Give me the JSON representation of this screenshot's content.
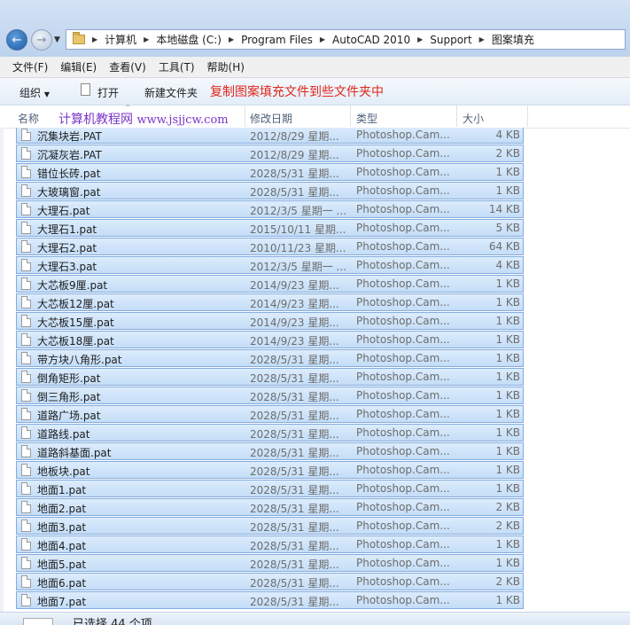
{
  "breadcrumb": [
    "计算机",
    "本地磁盘 (C:)",
    "Program Files",
    "AutoCAD 2010",
    "Support",
    "图案填充"
  ],
  "menu": [
    "文件(F)",
    "编辑(E)",
    "查看(V)",
    "工具(T)",
    "帮助(H)"
  ],
  "toolbar": {
    "organize": "组织",
    "open": "打开",
    "new_folder": "新建文件夹",
    "annotation": "复制图案填充文件到些文件夹中"
  },
  "columns": {
    "name": "名称",
    "date": "修改日期",
    "type": "类型",
    "size": "大小"
  },
  "watermark": {
    "text": "计算机教程网",
    "url": "www.jsjjcw.com"
  },
  "files": [
    {
      "name": "沉集块岩.PAT",
      "date": "2012/8/29 星期...",
      "type": "Photoshop.Cam...",
      "size": "4 KB"
    },
    {
      "name": "沉凝灰岩.PAT",
      "date": "2012/8/29 星期...",
      "type": "Photoshop.Cam...",
      "size": "2 KB"
    },
    {
      "name": "错位长砖.pat",
      "date": "2028/5/31 星期...",
      "type": "Photoshop.Cam...",
      "size": "1 KB"
    },
    {
      "name": "大玻璃窗.pat",
      "date": "2028/5/31 星期...",
      "type": "Photoshop.Cam...",
      "size": "1 KB"
    },
    {
      "name": "大理石.pat",
      "date": "2012/3/5 星期一 ...",
      "type": "Photoshop.Cam...",
      "size": "14 KB"
    },
    {
      "name": "大理石1.pat",
      "date": "2015/10/11 星期...",
      "type": "Photoshop.Cam...",
      "size": "5 KB"
    },
    {
      "name": "大理石2.pat",
      "date": "2010/11/23 星期...",
      "type": "Photoshop.Cam...",
      "size": "64 KB"
    },
    {
      "name": "大理石3.pat",
      "date": "2012/3/5 星期一 ...",
      "type": "Photoshop.Cam...",
      "size": "4 KB"
    },
    {
      "name": "大芯板9厘.pat",
      "date": "2014/9/23 星期...",
      "type": "Photoshop.Cam...",
      "size": "1 KB"
    },
    {
      "name": "大芯板12厘.pat",
      "date": "2014/9/23 星期...",
      "type": "Photoshop.Cam...",
      "size": "1 KB"
    },
    {
      "name": "大芯板15厘.pat",
      "date": "2014/9/23 星期...",
      "type": "Photoshop.Cam...",
      "size": "1 KB"
    },
    {
      "name": "大芯板18厘.pat",
      "date": "2014/9/23 星期...",
      "type": "Photoshop.Cam...",
      "size": "1 KB"
    },
    {
      "name": "带方块八角形.pat",
      "date": "2028/5/31 星期...",
      "type": "Photoshop.Cam...",
      "size": "1 KB"
    },
    {
      "name": "倒角矩形.pat",
      "date": "2028/5/31 星期...",
      "type": "Photoshop.Cam...",
      "size": "1 KB"
    },
    {
      "name": "倒三角形.pat",
      "date": "2028/5/31 星期...",
      "type": "Photoshop.Cam...",
      "size": "1 KB"
    },
    {
      "name": "道路广场.pat",
      "date": "2028/5/31 星期...",
      "type": "Photoshop.Cam...",
      "size": "1 KB"
    },
    {
      "name": "道路线.pat",
      "date": "2028/5/31 星期...",
      "type": "Photoshop.Cam...",
      "size": "1 KB"
    },
    {
      "name": "道路斜基面.pat",
      "date": "2028/5/31 星期...",
      "type": "Photoshop.Cam...",
      "size": "1 KB"
    },
    {
      "name": "地板块.pat",
      "date": "2028/5/31 星期...",
      "type": "Photoshop.Cam...",
      "size": "1 KB"
    },
    {
      "name": "地面1.pat",
      "date": "2028/5/31 星期...",
      "type": "Photoshop.Cam...",
      "size": "1 KB"
    },
    {
      "name": "地面2.pat",
      "date": "2028/5/31 星期...",
      "type": "Photoshop.Cam...",
      "size": "2 KB"
    },
    {
      "name": "地面3.pat",
      "date": "2028/5/31 星期...",
      "type": "Photoshop.Cam...",
      "size": "2 KB"
    },
    {
      "name": "地面4.pat",
      "date": "2028/5/31 星期...",
      "type": "Photoshop.Cam...",
      "size": "1 KB"
    },
    {
      "name": "地面5.pat",
      "date": "2028/5/31 星期...",
      "type": "Photoshop.Cam...",
      "size": "1 KB"
    },
    {
      "name": "地面6.pat",
      "date": "2028/5/31 星期...",
      "type": "Photoshop.Cam...",
      "size": "2 KB"
    },
    {
      "name": "地面7.pat",
      "date": "2028/5/31 星期...",
      "type": "Photoshop.Cam...",
      "size": "1 KB"
    }
  ],
  "status": {
    "text": "已选择 44 个项"
  },
  "colors": {
    "selection_fill": "#cfe3fa",
    "selection_border": "#84acdd",
    "annotation": "#e0271c",
    "watermark": "#7a35c8"
  },
  "icons": {
    "back": "back-arrow-icon",
    "forward": "forward-arrow-icon",
    "folder": "folder-icon",
    "file": "file-icon"
  }
}
